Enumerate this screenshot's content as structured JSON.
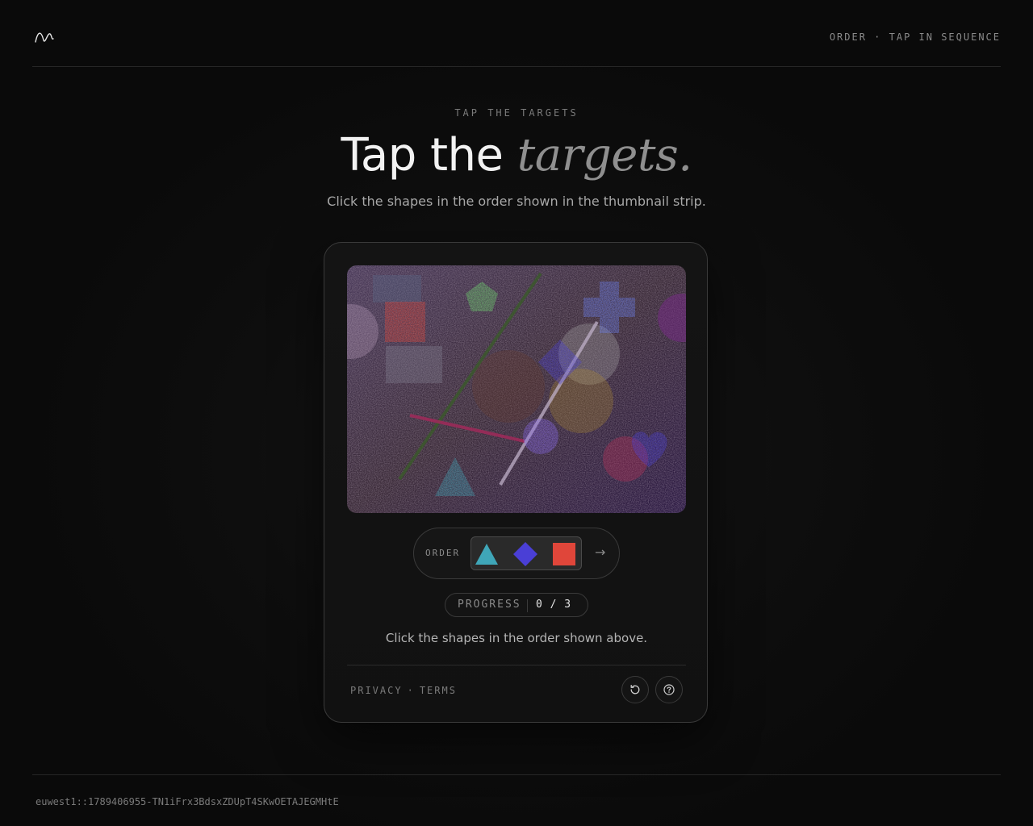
{
  "header": {
    "tagline": "ORDER · TAP IN SEQUENCE"
  },
  "hero": {
    "eyebrow": "TAP THE TARGETS",
    "title_main": "Tap the ",
    "title_emphasis": "targets.",
    "subtitle": "Click the shapes in the order shown in the thumbnail strip."
  },
  "challenge": {
    "shapes": [
      {
        "name": "red-square",
        "color": "#e0463a"
      },
      {
        "name": "green-pentagon",
        "color": "#6fdc6f"
      },
      {
        "name": "blue-cross",
        "color": "#6a7ff0"
      },
      {
        "name": "blue-diamond",
        "color": "#4a3fd6"
      },
      {
        "name": "purple-circle",
        "color": "#8a6af0"
      },
      {
        "name": "teal-triangle",
        "color": "#3fa6b8"
      },
      {
        "name": "blue-heart",
        "color": "#4a3fd6"
      }
    ],
    "order": {
      "label": "ORDER",
      "sequence": [
        "teal-triangle",
        "blue-diamond",
        "red-square"
      ],
      "next_icon": "arrow-right-icon"
    },
    "progress": {
      "label": "PROGRESS",
      "value": "0 / 3"
    },
    "instruction": "Click the shapes in the order shown above."
  },
  "footer": {
    "privacy": "PRIVACY",
    "separator": "·",
    "terms": "TERMS",
    "refresh_icon": "refresh-icon",
    "help_icon": "help-icon"
  },
  "session_id": "euwest1::1789406955-TN1iFrx3BdsxZDUpT4SKwOETAJEGMHtE"
}
